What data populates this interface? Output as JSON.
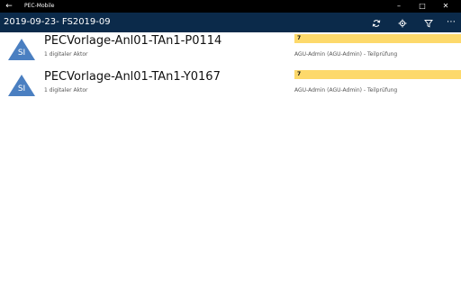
{
  "app": {
    "title": "PEC-Mobile",
    "back_glyph": "←",
    "minimize_glyph": "–",
    "maximize_glyph": "□",
    "close_glyph": "✕"
  },
  "header": {
    "title": "2019-09-23- FS2019-09",
    "icons": [
      "sync-icon",
      "location-icon",
      "filter-icon",
      "more-icon"
    ],
    "more_glyph": "⋯"
  },
  "colors": {
    "titlebar": "#000000",
    "header": "#0b2a4a",
    "badge": "#fdd96b",
    "avatar": "#4a7fc1"
  },
  "items": [
    {
      "avatar_label": "SI",
      "title": "PECVorlage-Anl01-TAn1-P0114",
      "subtitle": "1 digitaler Aktor",
      "badge": "7",
      "meta": "AGU-Admin (AGU-Admin) - Teilprüfung"
    },
    {
      "avatar_label": "SI",
      "title": "PECVorlage-Anl01-TAn1-Y0167",
      "subtitle": "1 digitaler Aktor",
      "badge": "7",
      "meta": "AGU-Admin (AGU-Admin) - Teilprüfung"
    }
  ]
}
